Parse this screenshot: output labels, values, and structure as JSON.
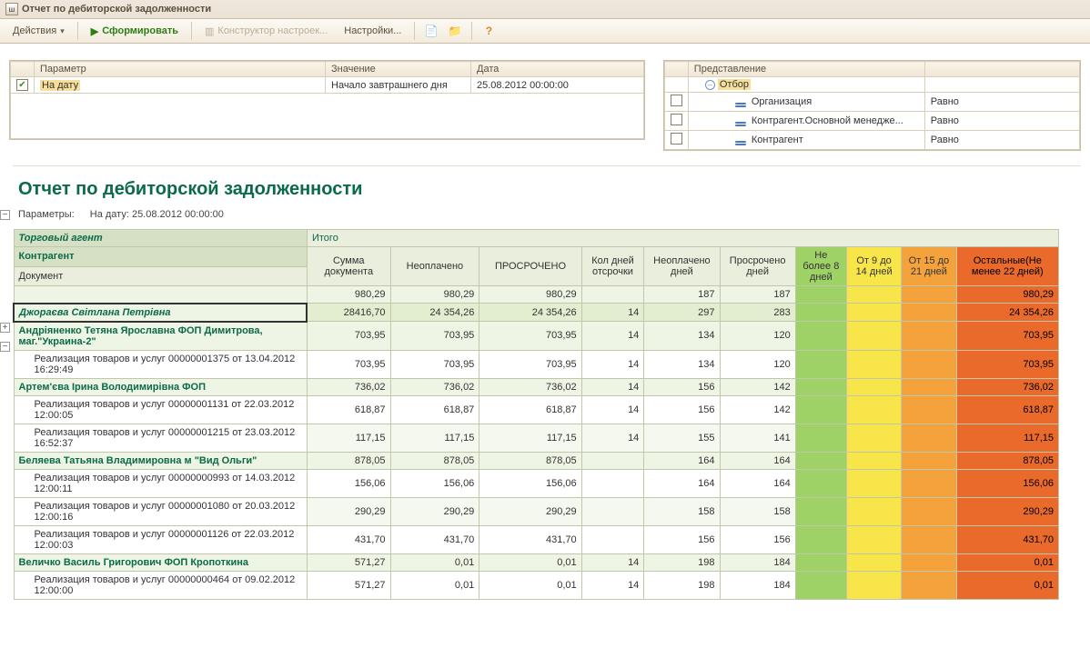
{
  "window": {
    "title": "Отчет по дебиторской задолженности"
  },
  "toolbar": {
    "actions": "Действия",
    "form": "Сформировать",
    "designer": "Конструктор настроек...",
    "settings": "Настройки..."
  },
  "params_panel": {
    "headers": {
      "param": "Параметр",
      "value": "Значение",
      "date": "Дата"
    },
    "row": {
      "param": "На дату",
      "value": "Начало завтрашнего дня",
      "date": "25.08.2012 00:00:00"
    }
  },
  "filter_panel": {
    "header": "Представление",
    "filter_label": "Отбор",
    "equal": "Равно",
    "rows": [
      {
        "name": "Организация"
      },
      {
        "name": "Контрагент.Основной менедже..."
      },
      {
        "name": "Контрагент"
      }
    ]
  },
  "report": {
    "title": "Отчет по дебиторской задолженности",
    "params_label": "Параметры:",
    "params_text": "На дату: 25.08.2012 00:00:00",
    "group_labels": {
      "agent": "Торговый агент",
      "contractor": "Контрагент",
      "document": "Документ",
      "itogo": "Итого"
    },
    "columns": [
      "Сумма документа",
      "Неоплачено",
      "ПРОСРОЧЕНО",
      "Кол дней отсрочки",
      "Неоплачено дней",
      "Просрочено дней",
      "Не более 8 дней",
      "От 9 до 14 дней",
      "От 15 до 21 дней",
      "Остальные(Не менее 22 дней)"
    ],
    "rows": [
      {
        "type": "empty",
        "sum": "980,29",
        "unpaid": "980,29",
        "overdue": "980,29",
        "grace": "",
        "unpaid_d": "187",
        "over_d": "187",
        "b1": "",
        "b2": "",
        "b3": "",
        "b4": "980,29"
      },
      {
        "type": "section",
        "label": "Джораєва Світлана Петрівна",
        "sum": "28416,70",
        "unpaid": "24 354,26",
        "overdue": "24 354,26",
        "grace": "14",
        "unpaid_d": "297",
        "over_d": "283",
        "b1": "",
        "b2": "",
        "b3": "",
        "b4": "24 354,26"
      },
      {
        "type": "agent",
        "label": "Андріяненко Тетяна Ярославна ФОП Димитрова, маг.\"Украина-2\"",
        "sum": "703,95",
        "unpaid": "703,95",
        "overdue": "703,95",
        "grace": "14",
        "unpaid_d": "134",
        "over_d": "120",
        "b1": "",
        "b2": "",
        "b3": "",
        "b4": "703,95"
      },
      {
        "type": "doc",
        "label": "Реализация товаров и услуг 00000001375 от 13.04.2012 16:29:49",
        "sum": "703,95",
        "unpaid": "703,95",
        "overdue": "703,95",
        "grace": "14",
        "unpaid_d": "134",
        "over_d": "120",
        "b1": "",
        "b2": "",
        "b3": "",
        "b4": "703,95"
      },
      {
        "type": "agent",
        "label": "Артем'єва Ірина Володимирівна ФОП",
        "sum": "736,02",
        "unpaid": "736,02",
        "overdue": "736,02",
        "grace": "14",
        "unpaid_d": "156",
        "over_d": "142",
        "b1": "",
        "b2": "",
        "b3": "",
        "b4": "736,02"
      },
      {
        "type": "doc",
        "label": "Реализация товаров и услуг 00000001131 от 22.03.2012 12:00:05",
        "sum": "618,87",
        "unpaid": "618,87",
        "overdue": "618,87",
        "grace": "14",
        "unpaid_d": "156",
        "over_d": "142",
        "b1": "",
        "b2": "",
        "b3": "",
        "b4": "618,87"
      },
      {
        "type": "doc",
        "alt": true,
        "label": "Реализация товаров и услуг 00000001215 от 23.03.2012 16:52:37",
        "sum": "117,15",
        "unpaid": "117,15",
        "overdue": "117,15",
        "grace": "14",
        "unpaid_d": "155",
        "over_d": "141",
        "b1": "",
        "b2": "",
        "b3": "",
        "b4": "117,15"
      },
      {
        "type": "agent",
        "label": "Беляева Татьяна Владимировна м \"Вид Ольги\"",
        "sum": "878,05",
        "unpaid": "878,05",
        "overdue": "878,05",
        "grace": "",
        "unpaid_d": "164",
        "over_d": "164",
        "b1": "",
        "b2": "",
        "b3": "",
        "b4": "878,05"
      },
      {
        "type": "doc",
        "label": "Реализация товаров и услуг 00000000993 от 14.03.2012 12:00:11",
        "sum": "156,06",
        "unpaid": "156,06",
        "overdue": "156,06",
        "grace": "",
        "unpaid_d": "164",
        "over_d": "164",
        "b1": "",
        "b2": "",
        "b3": "",
        "b4": "156,06"
      },
      {
        "type": "doc",
        "alt": true,
        "label": "Реализация товаров и услуг 00000001080 от 20.03.2012 12:00:16",
        "sum": "290,29",
        "unpaid": "290,29",
        "overdue": "290,29",
        "grace": "",
        "unpaid_d": "158",
        "over_d": "158",
        "b1": "",
        "b2": "",
        "b3": "",
        "b4": "290,29"
      },
      {
        "type": "doc",
        "label": "Реализация товаров и услуг 00000001126 от 22.03.2012 12:00:03",
        "sum": "431,70",
        "unpaid": "431,70",
        "overdue": "431,70",
        "grace": "",
        "unpaid_d": "156",
        "over_d": "156",
        "b1": "",
        "b2": "",
        "b3": "",
        "b4": "431,70"
      },
      {
        "type": "agent",
        "label": "Величко Василь Григорович ФОП Кропоткина",
        "sum": "571,27",
        "unpaid": "0,01",
        "overdue": "0,01",
        "grace": "14",
        "unpaid_d": "198",
        "over_d": "184",
        "b1": "",
        "b2": "",
        "b3": "",
        "b4": "0,01"
      },
      {
        "type": "doc",
        "label": "Реализация товаров и услуг 00000000464 от 09.02.2012 12:00:00",
        "sum": "571,27",
        "unpaid": "0,01",
        "overdue": "0,01",
        "grace": "14",
        "unpaid_d": "198",
        "over_d": "184",
        "b1": "",
        "b2": "",
        "b3": "",
        "b4": "0,01"
      }
    ]
  }
}
